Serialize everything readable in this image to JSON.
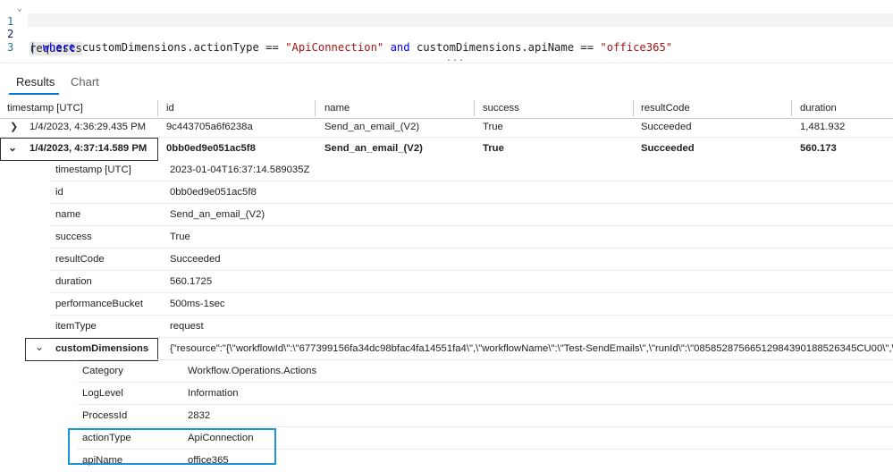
{
  "editor": {
    "lines": [
      {
        "number": "1",
        "text": "requests"
      },
      {
        "number": "2",
        "pipe": "| ",
        "kw_where": "where",
        "part1": " customDimensions.actionType == ",
        "str1": "\"ApiConnection\"",
        "kw_and": " and",
        "part2": " customDimensions.apiName == ",
        "str2": "\"office365\""
      },
      {
        "number": "3",
        "text": ""
      }
    ],
    "splitter": "..."
  },
  "tabs": {
    "results": "Results",
    "chart": "Chart"
  },
  "grid": {
    "columns": [
      "timestamp [UTC]",
      "id",
      "name",
      "success",
      "resultCode",
      "duration"
    ],
    "rows": [
      {
        "timestamp": "1/4/2023, 4:36:29.435 PM",
        "id": "9c443705a6f6238a",
        "name": "Send_an_email_(V2)",
        "success": "True",
        "resultCode": "Succeeded",
        "duration": "1,481.932"
      },
      {
        "timestamp": "1/4/2023, 4:37:14.589 PM",
        "id": "0bb0ed9e051ac5f8",
        "name": "Send_an_email_(V2)",
        "success": "True",
        "resultCode": "Succeeded",
        "duration": "560.173"
      }
    ],
    "details": [
      {
        "key": "timestamp [UTC]",
        "value": "2023-01-04T16:37:14.589035Z"
      },
      {
        "key": "id",
        "value": "0bb0ed9e051ac5f8"
      },
      {
        "key": "name",
        "value": "Send_an_email_(V2)"
      },
      {
        "key": "success",
        "value": "True"
      },
      {
        "key": "resultCode",
        "value": "Succeeded"
      },
      {
        "key": "duration",
        "value": "560.1725"
      },
      {
        "key": "performanceBucket",
        "value": "500ms-1sec"
      },
      {
        "key": "itemType",
        "value": "request"
      },
      {
        "key": "customDimensions",
        "value": "{\"resource\":\"{\\\"workflowId\\\":\\\"677399156fa34dc98bfac4fa14551fa4\\\",\\\"workflowName\\\":\\\"Test-SendEmails\\\",\\\"runId\\\":\\\"08585287566512984390188526345CU00\\\",\\\""
      }
    ],
    "custom_dimensions": [
      {
        "key": "Category",
        "value": "Workflow.Operations.Actions"
      },
      {
        "key": "LogLevel",
        "value": "Information"
      },
      {
        "key": "ProcessId",
        "value": "2832"
      },
      {
        "key": "actionType",
        "value": "ApiConnection"
      },
      {
        "key": "apiName",
        "value": "office365"
      }
    ]
  },
  "colors": {
    "accent": "#0078d4",
    "highlight_border": "#1a96d8",
    "keyword": "#0000ff",
    "string": "#a31515",
    "line_number": "#237893"
  },
  "icons": {
    "collapsed": "chevron-right-icon",
    "expanded": "chevron-down-icon"
  }
}
